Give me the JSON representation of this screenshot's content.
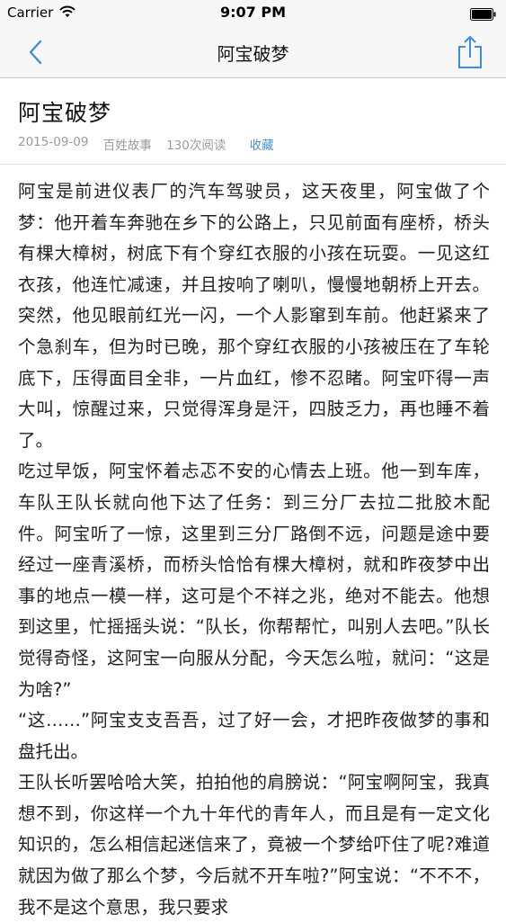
{
  "status_bar": {
    "carrier": "Carrier",
    "time": "9:07 PM"
  },
  "nav": {
    "title": "阿宝破梦"
  },
  "article": {
    "title": "阿宝破梦",
    "date": "2015-09-09",
    "category": "百姓故事",
    "views": "130次阅读",
    "favorite_label": "收藏",
    "paragraphs": [
      "阿宝是前进仪表厂的汽车驾驶员，这天夜里，阿宝做了个梦：他开着车奔驰在乡下的公路上，只见前面有座桥，桥头有棵大樟树，树底下有个穿红衣服的小孩在玩耍。一见这红衣孩，他连忙减速，并且按响了喇叭，慢慢地朝桥上开去。突然，他见眼前红光一闪，一个人影窜到车前。他赶紧来了个急刹车，但为时已晚，那个穿红衣服的小孩被压在了车轮底下，压得面目全非，一片血红，惨不忍睹。阿宝吓得一声大叫，惊醒过来，只觉得浑身是汗，四肢乏力，再也睡不着了。",
      "吃过早饭，阿宝怀着忐忑不安的心情去上班。他一到车库，车队王队长就向他下达了任务：到三分厂去拉二批胶木配件。阿宝听了一惊，这里到三分厂路倒不远，问题是途中要经过一座青溪桥，而桥头恰恰有棵大樟树，就和昨夜梦中出事的地点一模一样，这可是个不祥之兆，绝对不能去。他想到这里，忙摇摇头说：“队长，你帮帮忙，叫别人去吧。”队长觉得奇怪，这阿宝一向服从分配，今天怎么啦，就问：“这是为啥?”",
      "“这……”阿宝支支吾吾，过了好一会，才把昨夜做梦的事和盘托出。",
      "王队长听罢哈哈大笑，拍拍他的肩膀说：“阿宝啊阿宝，我真想不到，你这样一个九十年代的青年人，而且是有一定文化知识的，怎么相信起迷信来了，竟被一个梦给吓住了呢?难道就因为做了那么个梦，今后就不开车啦?”阿宝说：“不不不，我不是这个意思，我只要求"
    ]
  }
}
